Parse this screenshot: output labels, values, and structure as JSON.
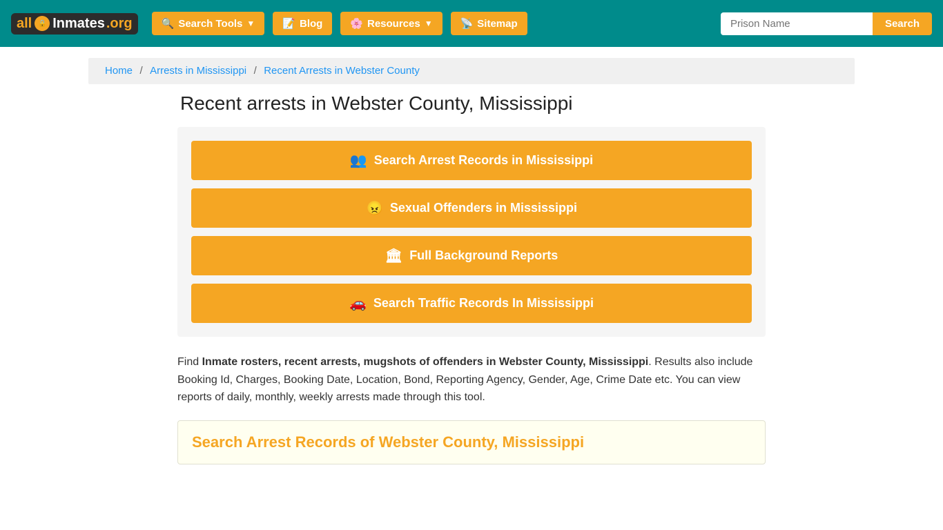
{
  "header": {
    "logo": {
      "all": "all",
      "inmates": "Inmates",
      "org": ".org"
    },
    "nav": [
      {
        "id": "search-tools",
        "label": "Search Tools",
        "icon": "🔍",
        "dropdown": true
      },
      {
        "id": "blog",
        "label": "Blog",
        "icon": "📝",
        "dropdown": false
      },
      {
        "id": "resources",
        "label": "Resources",
        "icon": "🌸",
        "dropdown": true
      },
      {
        "id": "sitemap",
        "label": "Sitemap",
        "icon": "📡",
        "dropdown": false
      }
    ],
    "search_placeholder": "Prison Name",
    "search_button": "Search"
  },
  "breadcrumb": {
    "items": [
      {
        "label": "Home",
        "link": true
      },
      {
        "label": "Arrests in Mississippi",
        "link": true
      },
      {
        "label": "Recent Arrests in Webster County",
        "link": false
      }
    ]
  },
  "main": {
    "page_title": "Recent arrests in Webster County, Mississippi",
    "buttons": [
      {
        "id": "arrest-records",
        "icon": "👥",
        "label": "Search Arrest Records in Mississippi"
      },
      {
        "id": "sexual-offenders",
        "icon": "😠",
        "label": "Sexual Offenders in Mississippi"
      },
      {
        "id": "background-reports",
        "icon": "🏛",
        "label": "Full Background Reports"
      },
      {
        "id": "traffic-records",
        "icon": "🚗",
        "label": "Search Traffic Records In Mississippi"
      }
    ],
    "description": {
      "intro": "Find ",
      "bold_text": "Inmate rosters, recent arrests, mugshots of offenders in Webster County, Mississippi",
      "rest": ". Results also include Booking Id, Charges, Booking Date, Location, Bond, Reporting Agency, Gender, Age, Crime Date etc. You can view reports of daily, monthly, weekly arrests made through this tool."
    },
    "bottom_section_title": "Search Arrest Records of Webster County, Mississippi"
  }
}
